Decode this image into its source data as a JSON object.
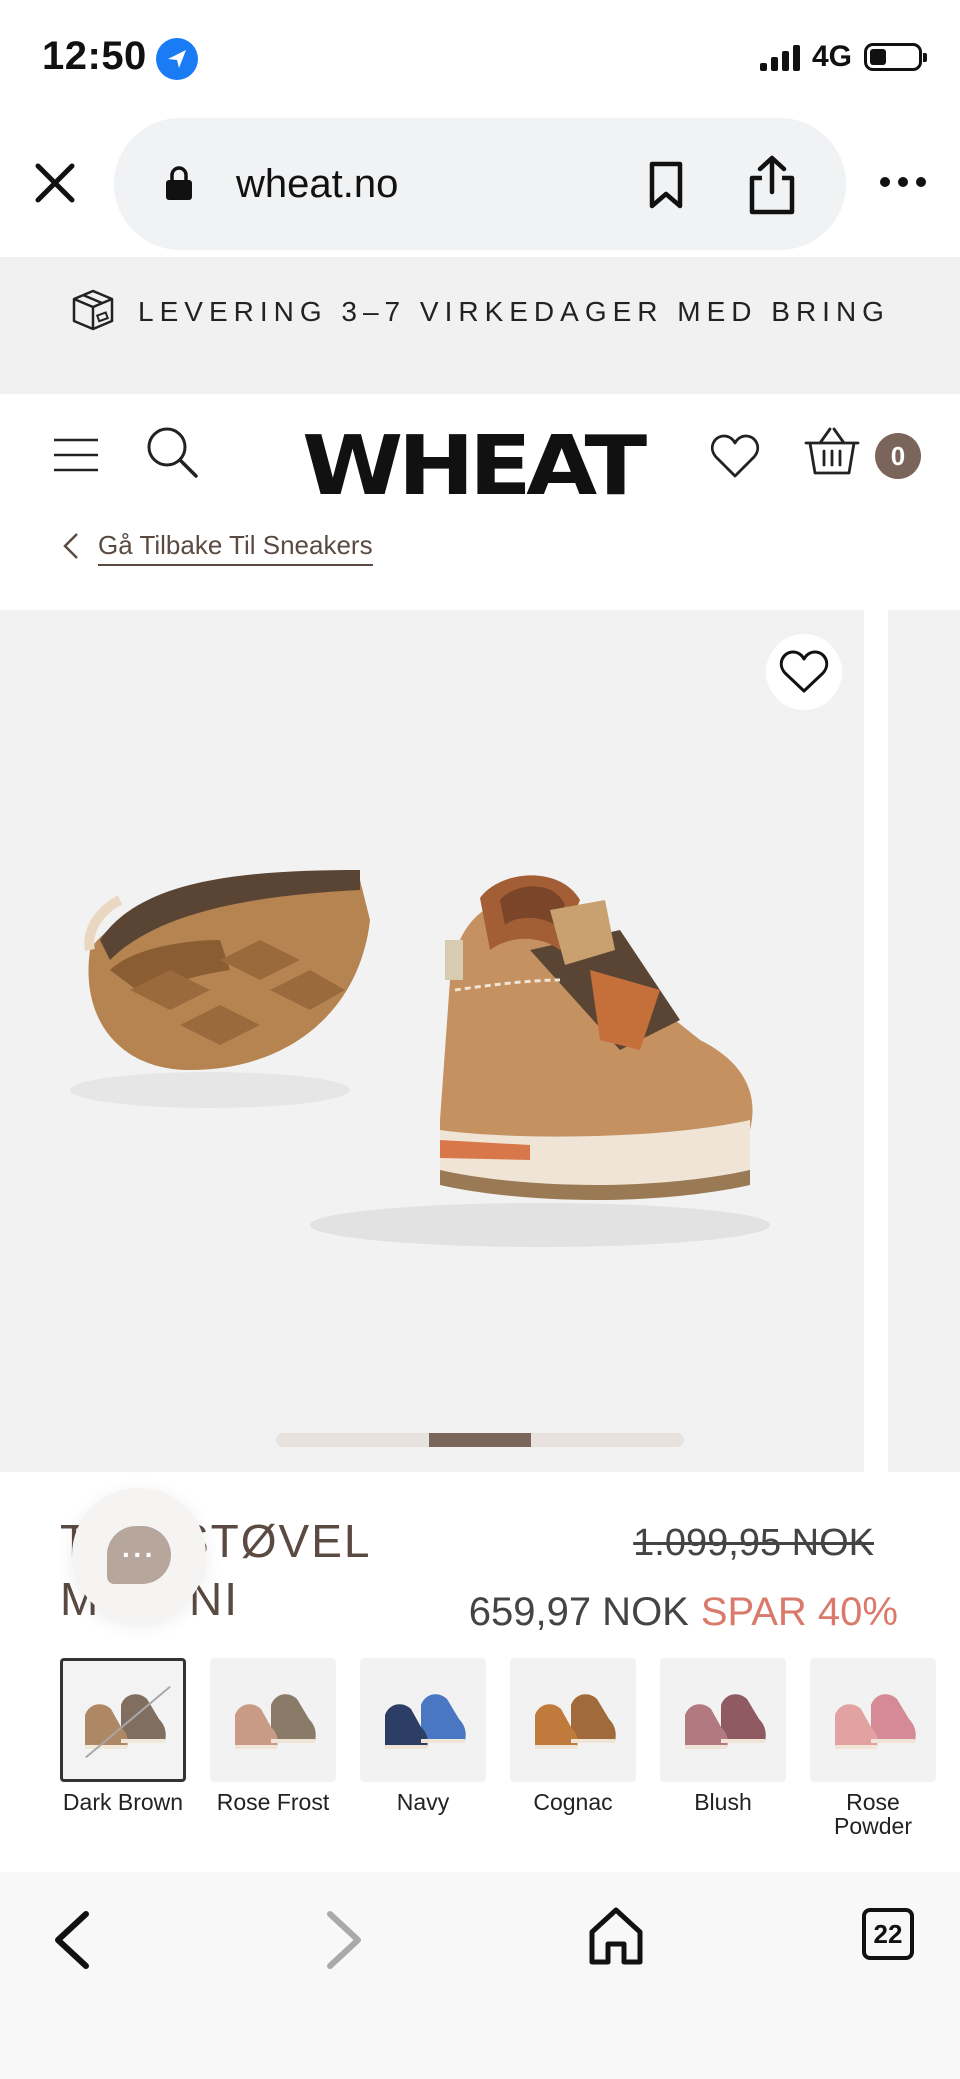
{
  "status_bar": {
    "time": "12:50",
    "network": "4G"
  },
  "browser": {
    "url": "wheat.no"
  },
  "banner": {
    "text": "LEVERING 3–7 VIRKEDAGER MED BRING"
  },
  "header": {
    "logo": "WHEAT",
    "cart_count": "0"
  },
  "breadcrumb": {
    "label": "Gå Tilbake Til Sneakers"
  },
  "gallery": {
    "slide_progress": 0.5,
    "accent": "#7b6459"
  },
  "product": {
    "name_line1": "T      STØVEL",
    "name_line2": "M      NI",
    "old_price": "1.099,95 NOK",
    "new_price": "659,97 NOK",
    "discount": "SPAR 40%"
  },
  "colors": [
    {
      "label": "Dark Brown",
      "selected": true,
      "c1": "#a0744a",
      "c2": "#6a5545"
    },
    {
      "label": "Rose Frost",
      "selected": false,
      "c1": "#c99a85",
      "c2": "#8a7a68"
    },
    {
      "label": "Navy",
      "selected": false,
      "c1": "#2d3e66",
      "c2": "#4a77c2"
    },
    {
      "label": "Cognac",
      "selected": false,
      "c1": "#c07a3c",
      "c2": "#a06a3a"
    },
    {
      "label": "Blush",
      "selected": false,
      "c1": "#b27a80",
      "c2": "#8f5a62"
    },
    {
      "label": "Rose Powder",
      "selected": false,
      "c1": "#e3a2a2",
      "c2": "#d58a95"
    }
  ],
  "bottom_nav": {
    "tabs_count": "22"
  }
}
